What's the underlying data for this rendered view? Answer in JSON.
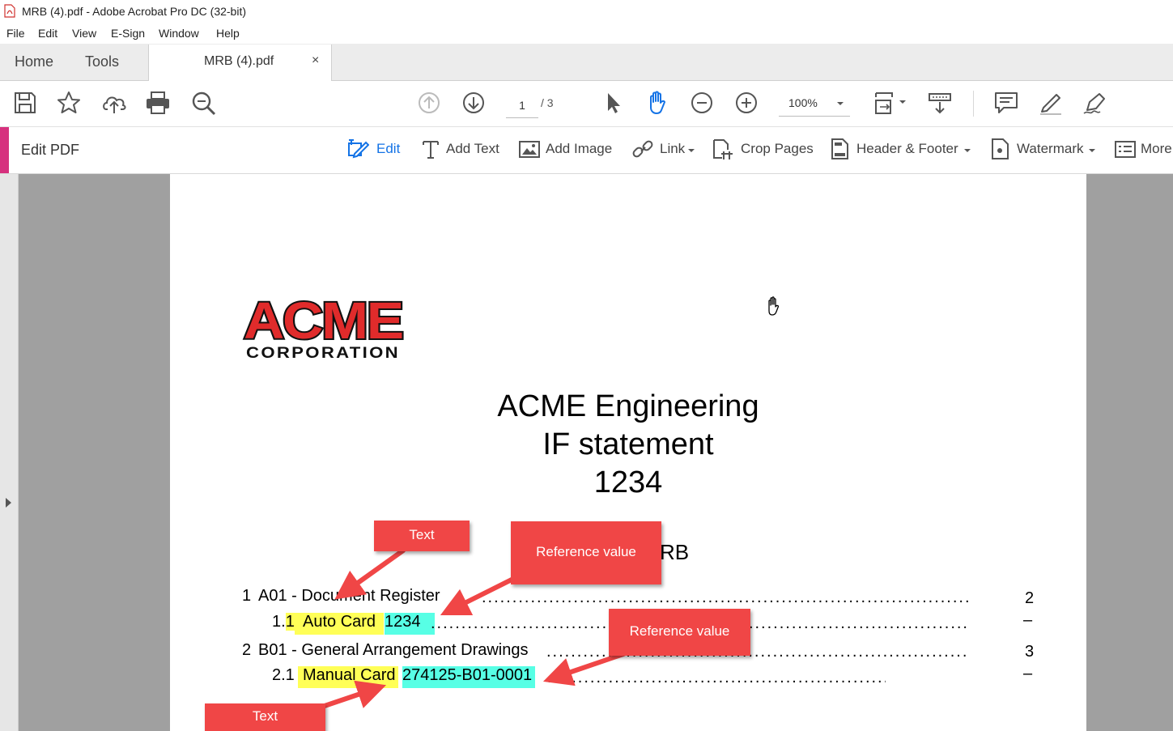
{
  "window": {
    "title": "MRB (4).pdf - Adobe Acrobat Pro DC (32-bit)"
  },
  "menu": [
    "File",
    "Edit",
    "View",
    "E-Sign",
    "Window",
    "Help"
  ],
  "tabs": {
    "home": "Home",
    "tools": "Tools",
    "document": "MRB (4).pdf",
    "close": "×"
  },
  "toolbar": {
    "page_current": "1",
    "page_total": "/ 3",
    "zoom": "100%"
  },
  "edit_bar": {
    "title": "Edit PDF",
    "tools": {
      "edit": "Edit",
      "add_text": "Add Text",
      "add_image": "Add Image",
      "link": "Link",
      "crop_pages": "Crop Pages",
      "header_footer": "Header & Footer",
      "watermark": "Watermark",
      "more": "More"
    }
  },
  "document": {
    "logo": {
      "line1": "ACME",
      "line2": "CORPORATION"
    },
    "title_lines": [
      "ACME Engineering",
      "IF statement",
      "1234"
    ],
    "heading_partial": "RB",
    "toc": [
      {
        "num": "1",
        "label": "A01 - Document Register",
        "page": "2"
      },
      {
        "num": "1.1",
        "text": "Auto Card",
        "ref": "1234",
        "page": "–"
      },
      {
        "num": "2",
        "label": "B01 - General Arrangement Drawings",
        "page": "3"
      },
      {
        "num": "2.1",
        "text": "Manual Card",
        "ref": "274125-B01-0001",
        "page": "–"
      }
    ]
  },
  "callouts": {
    "text_top": "Text",
    "ref_top": "Reference value",
    "ref_bottom": "Reference value",
    "text_bottom": "Text"
  },
  "colors": {
    "accent_edit": "#d6317e",
    "callout": "#f04646",
    "highlight_text": "#ffff57",
    "highlight_ref": "#57ffe5",
    "acrobat_blue": "#1473e6"
  }
}
